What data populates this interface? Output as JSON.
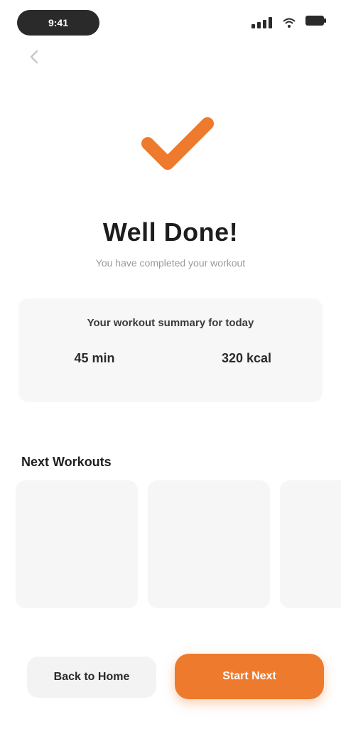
{
  "colors": {
    "accent": "#ee7a2e",
    "text_dark": "#1f1f1f",
    "text_muted": "#9a9a9a",
    "surface": "#f7f7f7"
  },
  "status_bar": {
    "time": "9:41",
    "icons": [
      "signal-icon",
      "wifi-icon",
      "battery-icon"
    ]
  },
  "header": {
    "back_icon": "chevron-left-icon"
  },
  "hero": {
    "icon": "check-icon",
    "title": "Well Done!",
    "subtitle": "You have completed your workout"
  },
  "summary": {
    "heading": "Your workout summary for today",
    "stats": [
      {
        "value": "45 min",
        "label": ""
      },
      {
        "value": "320 kcal",
        "label": ""
      }
    ]
  },
  "section": {
    "title": "Next Workouts",
    "tiles": [
      {
        "label": ""
      },
      {
        "label": ""
      },
      {
        "label": ""
      }
    ]
  },
  "actions": {
    "secondary_label": "Back to Home",
    "primary_label": "Start Next"
  }
}
